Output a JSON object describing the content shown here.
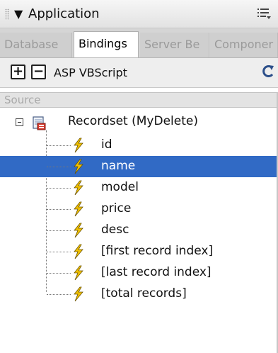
{
  "panel": {
    "title": "Application",
    "title_arrow": "▼"
  },
  "tabs": [
    {
      "label": "Database",
      "active": false
    },
    {
      "label": "Bindings",
      "active": true
    },
    {
      "label": "Server Be",
      "active": false
    },
    {
      "label": "Componer",
      "active": false
    }
  ],
  "toolbar": {
    "add_label": "+",
    "remove_label": "−",
    "document_type": "ASP VBScript"
  },
  "column_header": "Source",
  "tree": {
    "root_label": "Recordset (MyDelete)",
    "root_expanded": true,
    "items": [
      {
        "label": "id",
        "selected": false
      },
      {
        "label": "name",
        "selected": true
      },
      {
        "label": "model",
        "selected": false
      },
      {
        "label": "price",
        "selected": false
      },
      {
        "label": "desc",
        "selected": false
      },
      {
        "label": "[first record index]",
        "selected": false
      },
      {
        "label": "[last record index]",
        "selected": false
      },
      {
        "label": "[total records]",
        "selected": false
      }
    ]
  },
  "colors": {
    "selection": "#316ac5",
    "bolt": "#f2c200"
  }
}
